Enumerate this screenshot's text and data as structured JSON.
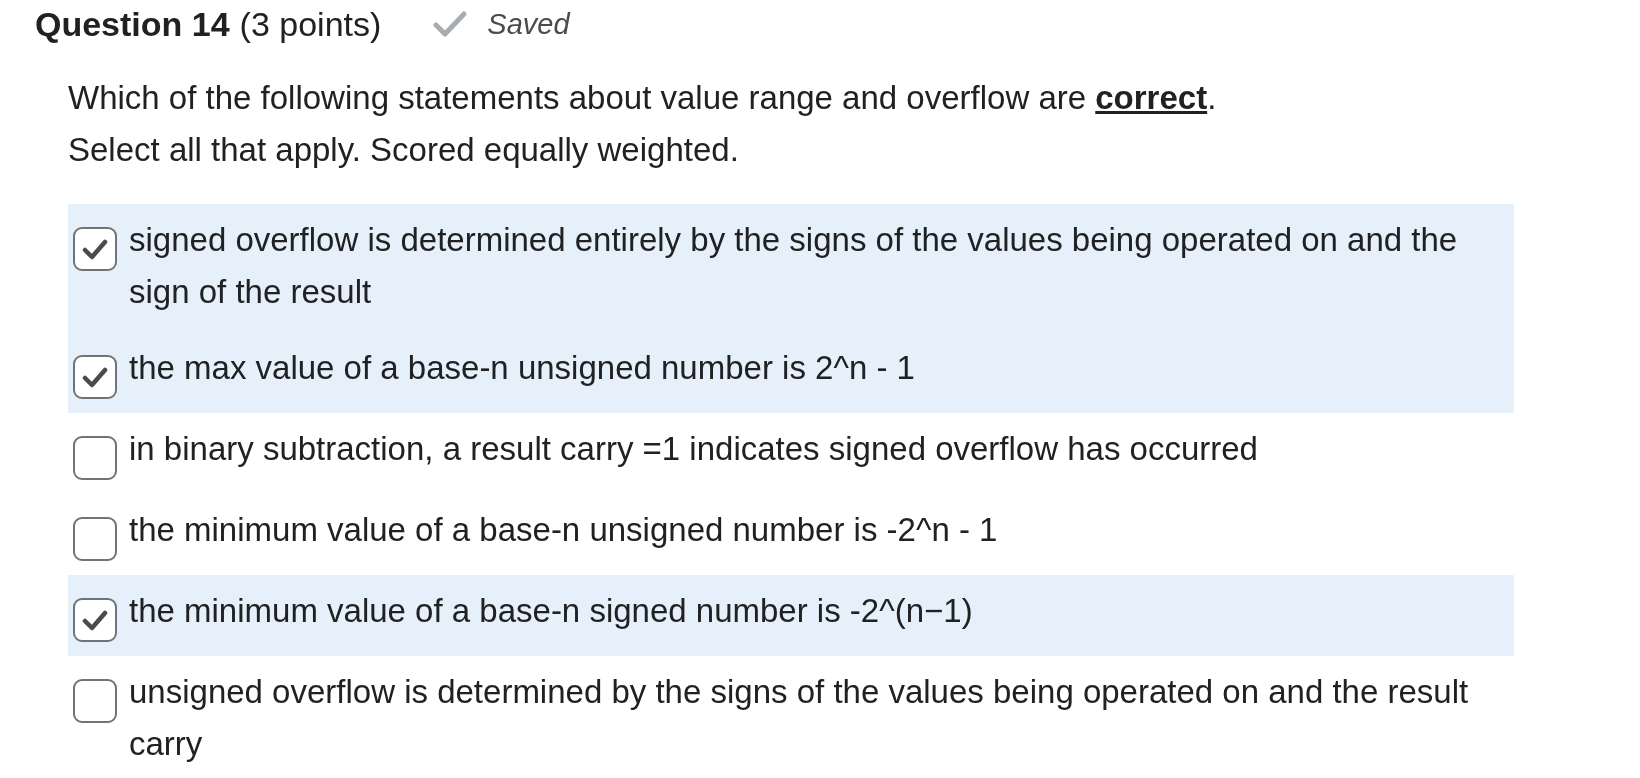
{
  "question": {
    "title": "Question 14",
    "points": "(3 points)",
    "save_status": "Saved",
    "prompt": "Which of the following statements about value range and overflow are **correct**.",
    "instructions": "Select all that apply. Scored equally weighted."
  },
  "options": [
    {
      "label": "signed overflow is determined entirely by the signs of the values being operated on and the sign of the result",
      "checked": true
    },
    {
      "label": "the max value of a base-n unsigned number is 2^n - 1",
      "checked": true
    },
    {
      "label": "in binary subtraction, a result carry =1 indicates signed overflow has occurred",
      "checked": false
    },
    {
      "label": "the minimum value of a base-n unsigned number is -2^n - 1",
      "checked": false
    },
    {
      "label": "the minimum value of a base-n signed number is -2^(n−1)",
      "checked": true
    },
    {
      "label": "unsigned overflow is determined by the signs of the values being operated on and the result carry",
      "checked": false
    }
  ]
}
